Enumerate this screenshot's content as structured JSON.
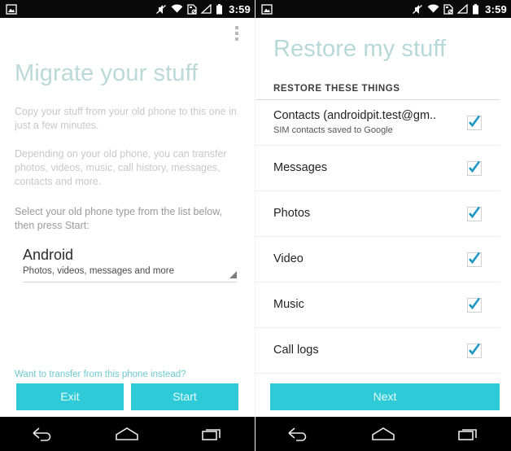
{
  "statusbar": {
    "time": "3:59",
    "icons": {
      "notification": "screenshot-image-icon",
      "vibrate_muted": "vibrate-muted-icon",
      "wifi": "wifi-icon",
      "sdcard": "sdcard-icon",
      "signal": "signal-triangle-icon",
      "battery": "battery-icon"
    }
  },
  "left_screen": {
    "overflow_menu": "overflow-menu-icon",
    "title": "Migrate your stuff",
    "paragraph1": "Copy your stuff from your old phone to this one in just a few minutes.",
    "paragraph2": "Depending on your old phone, you can transfer photos, videos, music, call history, messages, contacts and more.",
    "paragraph3": "Select your old phone type from the list below, then press Start:",
    "spinner": {
      "value": "Android",
      "subtitle": "Photos, videos, messages and more",
      "arrow_icon": "dropdown-arrow-icon"
    },
    "link_text": "Want to transfer from this phone instead?",
    "buttons": {
      "exit": "Exit",
      "start": "Start"
    }
  },
  "right_screen": {
    "title": "Restore my stuff",
    "section_header": "RESTORE THESE THINGS",
    "items": [
      {
        "title": "Contacts (androidpit.test@gm..",
        "subtitle": "SIM contacts saved to Google",
        "checked": true
      },
      {
        "title": "Messages",
        "subtitle": "",
        "checked": true
      },
      {
        "title": "Photos",
        "subtitle": "",
        "checked": true
      },
      {
        "title": "Video",
        "subtitle": "",
        "checked": true
      },
      {
        "title": "Music",
        "subtitle": "",
        "checked": true
      },
      {
        "title": "Call logs",
        "subtitle": "",
        "checked": true
      }
    ],
    "buttons": {
      "next": "Next"
    }
  },
  "navbar": {
    "back": "back-icon",
    "home": "home-icon",
    "recents": "recents-icon"
  },
  "colors": {
    "accent_teal": "#2ecad8",
    "title_teal": "#bcd9d9",
    "link_teal": "#6fc9cf",
    "check_blue": "#2196c4"
  }
}
